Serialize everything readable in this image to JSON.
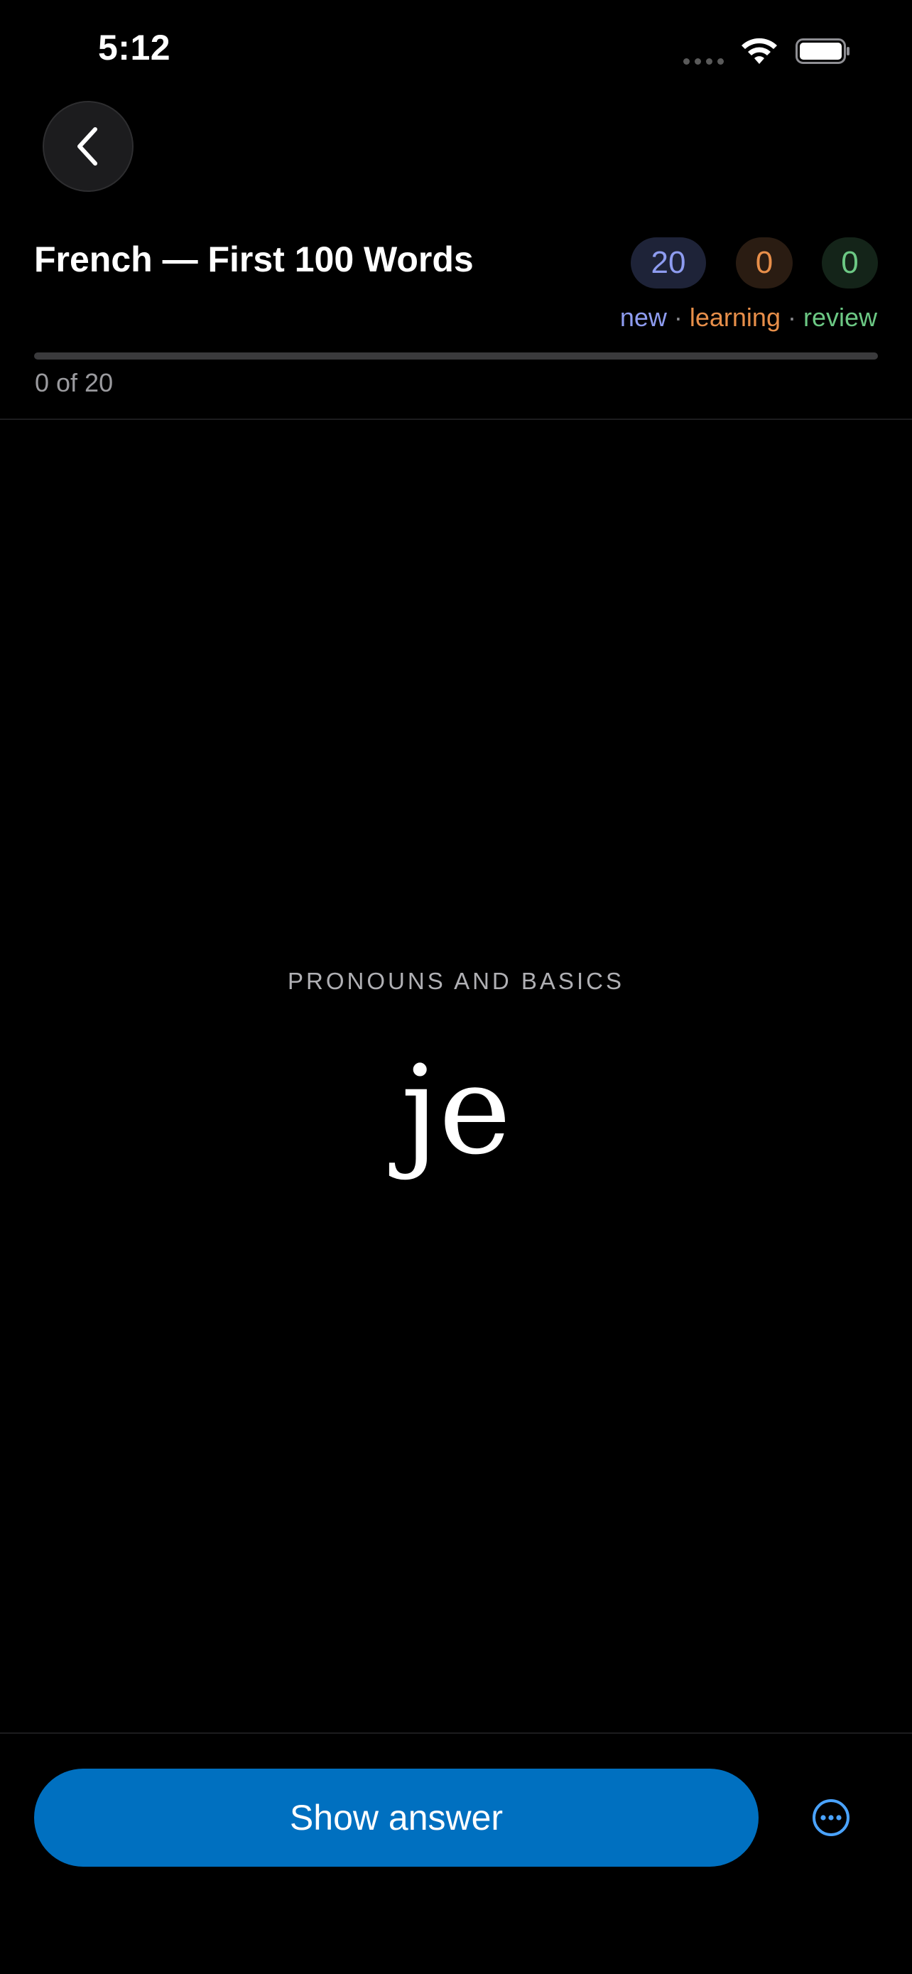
{
  "status_bar": {
    "time": "5:12"
  },
  "header": {
    "back_icon": "chevron-left-icon",
    "deck_title": "French — First 100 Words",
    "counts": {
      "new": "20",
      "learning": "0",
      "review": "0"
    },
    "legend": {
      "new": "new",
      "learning": "learning",
      "review": "review",
      "separator": "·"
    },
    "progress": {
      "label": "0 of 20",
      "fraction": 0
    }
  },
  "card": {
    "category": "PRONOUNS AND BASICS",
    "term": "je"
  },
  "footer": {
    "show_answer_label": "Show answer",
    "more_icon": "ellipsis-circle-icon"
  },
  "colors": {
    "background": "#000000",
    "accent_button": "#0070c0",
    "new": "#8e9cf0",
    "learning": "#e88f4a",
    "review": "#6cc884"
  }
}
